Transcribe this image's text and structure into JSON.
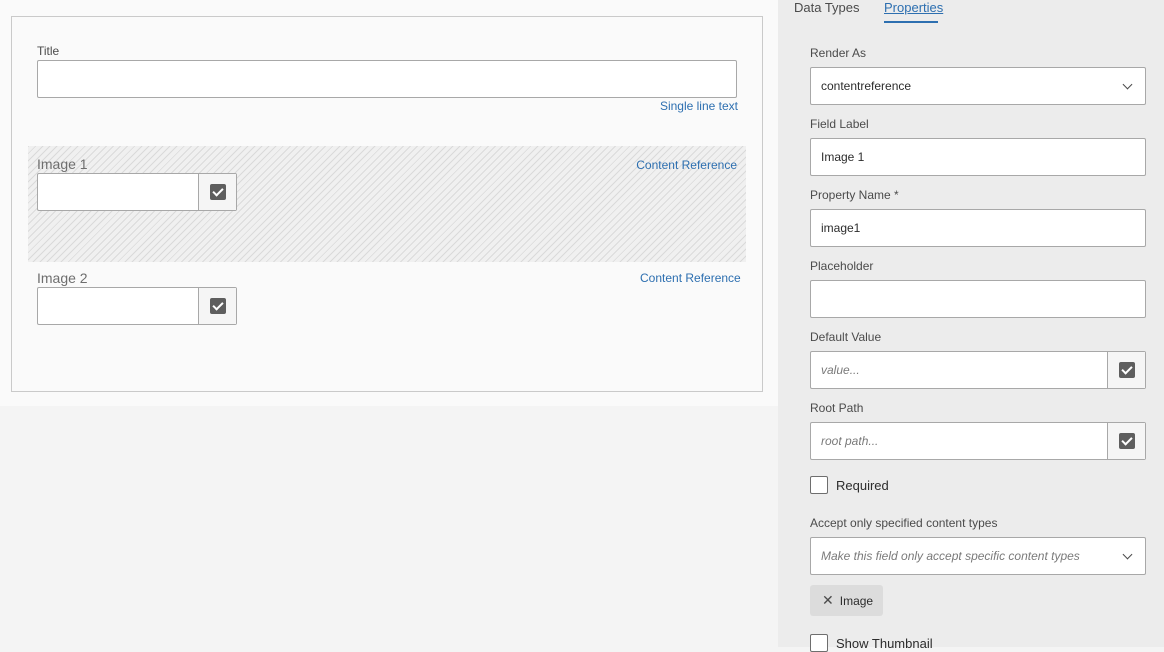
{
  "canvas": {
    "fields": [
      {
        "label": "Title",
        "type": "Single line text"
      },
      {
        "label": "Image 1",
        "type": "Content Reference"
      },
      {
        "label": "Image 2",
        "type": "Content Reference"
      }
    ]
  },
  "panel": {
    "tabs": [
      {
        "label": "Data Types"
      },
      {
        "label": "Properties"
      }
    ],
    "render_as": {
      "label": "Render As",
      "value": "contentreference"
    },
    "field_label": {
      "label": "Field Label",
      "value": "Image 1"
    },
    "property_name": {
      "label": "Property Name *",
      "value": "image1"
    },
    "placeholder": {
      "label": "Placeholder",
      "value": ""
    },
    "default_value": {
      "label": "Default Value",
      "placeholder": "value..."
    },
    "root_path": {
      "label": "Root Path",
      "placeholder": "root path..."
    },
    "required": {
      "label": "Required"
    },
    "accept_types": {
      "label": "Accept only specified content types",
      "placeholder": "Make this field only accept specific content types",
      "tags": [
        "Image"
      ]
    },
    "show_thumbnail": {
      "label": "Show Thumbnail"
    }
  },
  "colors": {
    "accent": "#2d6fb0",
    "panel_bg": "#ececec",
    "canvas_bg": "#fafafa"
  }
}
